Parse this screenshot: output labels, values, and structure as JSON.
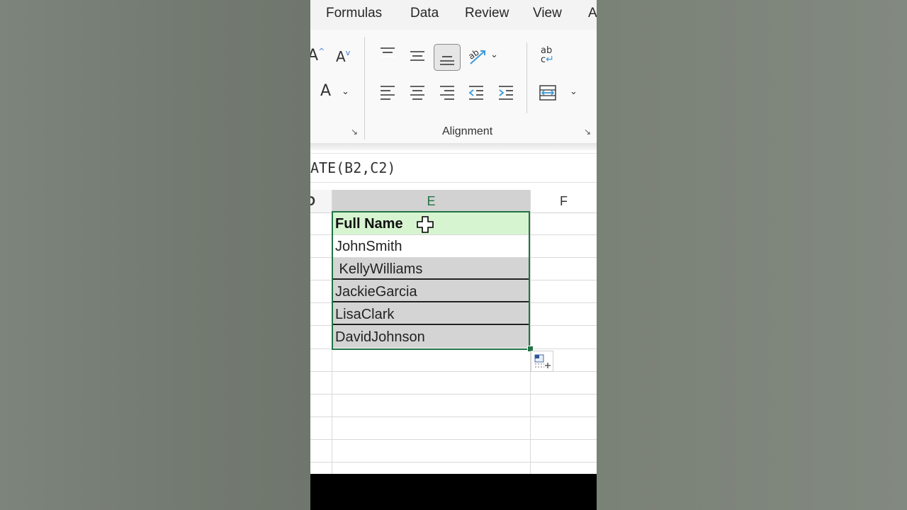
{
  "menu": {
    "items": [
      "Formulas",
      "Data",
      "Review",
      "View",
      "A"
    ]
  },
  "ribbon": {
    "font_grow_glyph": "A",
    "font_shrink_glyph": "A",
    "font_color_glyph": "A",
    "wrap_text_glyph": "ab\nc",
    "alignment_label": "Alignment"
  },
  "formula_bar": {
    "text": "ATE(B2,C2)"
  },
  "columns": {
    "d_partial": "D",
    "e": "E",
    "f": "F"
  },
  "cells": {
    "header": "Full Name",
    "rows": [
      "JohnSmith",
      " KellyWilliams",
      "JackieGarcia",
      "LisaClark",
      "DavidJohnson"
    ]
  },
  "colors": {
    "accent": "#217346",
    "header_fill": "#d6f4d0",
    "selection_fill": "#d4d4d4"
  }
}
